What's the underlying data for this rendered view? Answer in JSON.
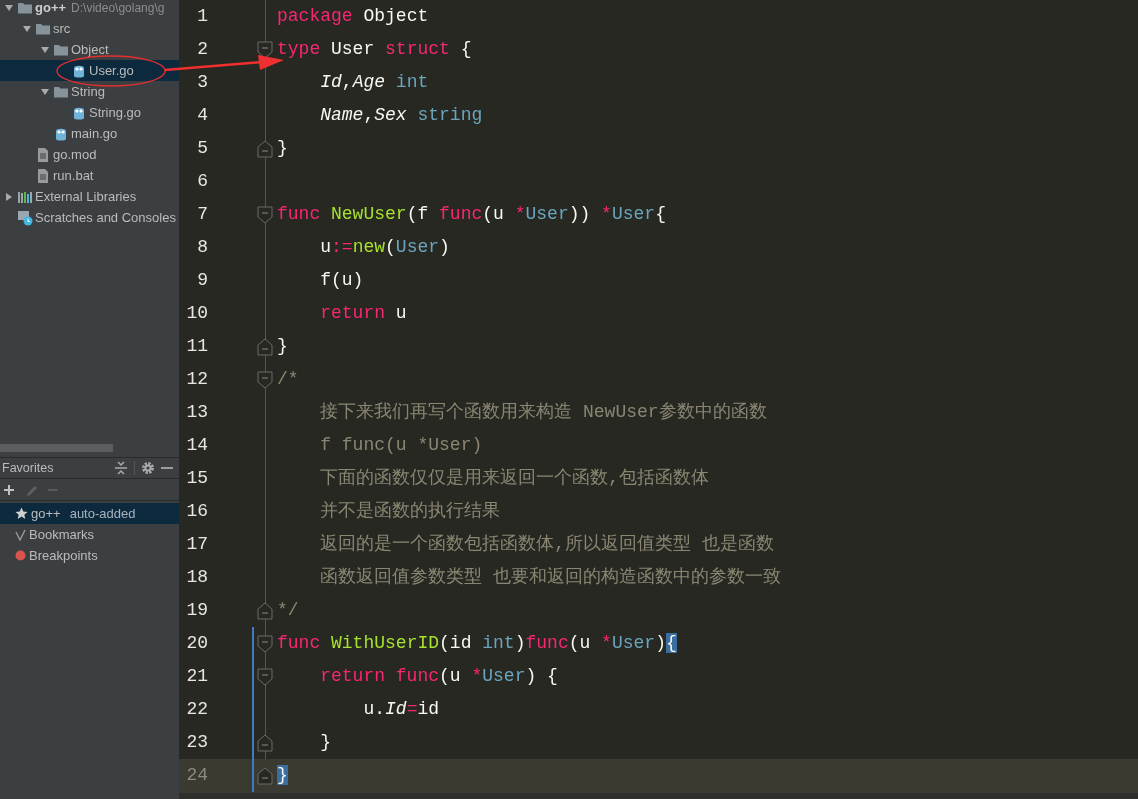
{
  "project_tree": {
    "items": [
      {
        "label": "go++",
        "path": "D:\\video\\golang\\g",
        "kind": "folder",
        "expanded": true,
        "selected": false,
        "children": [
          {
            "label": "src",
            "kind": "folder",
            "expanded": true,
            "selected": false,
            "children": [
              {
                "label": "Object",
                "kind": "folder",
                "expanded": true,
                "selected": false,
                "children": [
                  {
                    "label": "User.go",
                    "kind": "gofile",
                    "selected": true
                  }
                ]
              },
              {
                "label": "String",
                "kind": "folder",
                "expanded": true,
                "selected": false,
                "children": [
                  {
                    "label": "String.go",
                    "kind": "gofile",
                    "selected": false
                  }
                ]
              },
              {
                "label": "main.go",
                "kind": "gofile",
                "selected": false
              }
            ]
          },
          {
            "label": "go.mod",
            "kind": "file",
            "selected": false
          },
          {
            "label": "run.bat",
            "kind": "file",
            "selected": false
          }
        ]
      },
      {
        "label": "External Libraries",
        "kind": "libraries",
        "expanded": false,
        "selected": false
      },
      {
        "label": "Scratches and Consoles",
        "kind": "scratches",
        "selected": false
      }
    ]
  },
  "favorites": {
    "title": "Favorites",
    "toolbar": [
      {
        "kind": "add",
        "disabled": false
      },
      {
        "kind": "edit",
        "disabled": true
      },
      {
        "kind": "remove",
        "disabled": true
      }
    ],
    "items": [
      {
        "label": "go++",
        "note": "auto-added",
        "kind": "star",
        "selected": true
      },
      {
        "label": "Bookmarks",
        "kind": "check",
        "selected": false
      },
      {
        "label": "Breakpoints",
        "kind": "dot",
        "color": "#d9534f",
        "selected": false
      }
    ]
  },
  "editor": {
    "lines": [
      {
        "number": "1",
        "kind": "code",
        "changed": false,
        "current": false,
        "tokens": [
          {
            "kind": "kw",
            "text": "package"
          },
          {
            "kind": "plain",
            "text": " Object"
          }
        ]
      },
      {
        "number": "2",
        "kind": "fold-start",
        "changed": false,
        "current": false,
        "tokens": [
          {
            "kind": "kw",
            "text": "type"
          },
          {
            "kind": "plain",
            "text": " User "
          },
          {
            "kind": "kw",
            "text": "struct"
          },
          {
            "kind": "plain",
            "text": " {"
          }
        ]
      },
      {
        "number": "3",
        "kind": "code",
        "changed": false,
        "current": false,
        "tokens": [
          {
            "kind": "field",
            "text": "    Id"
          },
          {
            "kind": "plain",
            "text": ","
          },
          {
            "kind": "field",
            "text": "Age"
          },
          {
            "kind": "type",
            "text": " int"
          }
        ]
      },
      {
        "number": "4",
        "kind": "code",
        "changed": false,
        "current": false,
        "tokens": [
          {
            "kind": "field",
            "text": "    Name"
          },
          {
            "kind": "plain",
            "text": ","
          },
          {
            "kind": "field",
            "text": "Sex"
          },
          {
            "kind": "type",
            "text": " string"
          }
        ]
      },
      {
        "number": "5",
        "kind": "fold-end",
        "changed": false,
        "current": false,
        "tokens": [
          {
            "kind": "plain",
            "text": "}"
          }
        ]
      },
      {
        "number": "6",
        "kind": "code",
        "changed": false,
        "current": false
      },
      {
        "number": "7",
        "kind": "fold-start",
        "changed": false,
        "current": false,
        "tokens": [
          {
            "kind": "kw",
            "text": "func"
          },
          {
            "kind": "fn",
            "text": " NewUser"
          },
          {
            "kind": "plain",
            "text": "(f "
          },
          {
            "kind": "kw",
            "text": "func"
          },
          {
            "kind": "plain",
            "text": "(u "
          },
          {
            "kind": "kw",
            "text": "*"
          },
          {
            "kind": "type",
            "text": "User"
          },
          {
            "kind": "plain",
            "text": ")) "
          },
          {
            "kind": "kw",
            "text": "*"
          },
          {
            "kind": "type",
            "text": "User"
          },
          {
            "kind": "plain",
            "text": "{"
          }
        ]
      },
      {
        "number": "8",
        "kind": "code",
        "changed": false,
        "current": false,
        "tokens": [
          {
            "kind": "plain",
            "text": "    u"
          },
          {
            "kind": "kw",
            "text": ":="
          },
          {
            "kind": "fn",
            "text": "new"
          },
          {
            "kind": "plain",
            "text": "("
          },
          {
            "kind": "type",
            "text": "User"
          },
          {
            "kind": "plain",
            "text": ")"
          }
        ]
      },
      {
        "number": "9",
        "kind": "code",
        "changed": false,
        "current": false,
        "tokens": [
          {
            "kind": "plain",
            "text": "    f(u)"
          }
        ]
      },
      {
        "number": "10",
        "kind": "code",
        "changed": false,
        "current": false,
        "tokens": [
          {
            "kind": "kw",
            "text": "    return"
          },
          {
            "kind": "plain",
            "text": " u"
          }
        ]
      },
      {
        "number": "11",
        "kind": "fold-end",
        "changed": false,
        "current": false,
        "tokens": [
          {
            "kind": "plain",
            "text": "}"
          }
        ]
      },
      {
        "number": "12",
        "kind": "fold-start",
        "changed": false,
        "current": false,
        "tokens": [
          {
            "kind": "comment",
            "text": "/*"
          }
        ]
      },
      {
        "number": "13",
        "kind": "code",
        "changed": false,
        "current": false,
        "tokens": [
          {
            "kind": "comment",
            "text": "    接下来我们再写个函数用来构造 NewUser参数中的函数"
          }
        ]
      },
      {
        "number": "14",
        "kind": "code",
        "changed": false,
        "current": false,
        "tokens": [
          {
            "kind": "comment",
            "text": "    f func(u *User)"
          }
        ]
      },
      {
        "number": "15",
        "kind": "code",
        "changed": false,
        "current": false,
        "tokens": [
          {
            "kind": "comment",
            "text": "    下面的函数仅仅是用来返回一个函数,包括函数体"
          }
        ]
      },
      {
        "number": "16",
        "kind": "code",
        "changed": false,
        "current": false,
        "tokens": [
          {
            "kind": "comment",
            "text": "    并不是函数的执行结果"
          }
        ]
      },
      {
        "number": "17",
        "kind": "code",
        "changed": false,
        "current": false,
        "tokens": [
          {
            "kind": "comment",
            "text": "    返回的是一个函数包括函数体,所以返回值类型 也是函数"
          }
        ]
      },
      {
        "number": "18",
        "kind": "code",
        "changed": false,
        "current": false,
        "tokens": [
          {
            "kind": "comment",
            "text": "    函数返回值参数类型 也要和返回的构造函数中的参数一致"
          }
        ]
      },
      {
        "number": "19",
        "kind": "fold-end",
        "changed": false,
        "current": false,
        "tokens": [
          {
            "kind": "comment",
            "text": "*/"
          }
        ]
      },
      {
        "number": "20",
        "kind": "fold-start",
        "changed": true,
        "current": false,
        "tokens": [
          {
            "kind": "kw",
            "text": "func"
          },
          {
            "kind": "fn",
            "text": " WithUserID"
          },
          {
            "kind": "plain",
            "text": "(id "
          },
          {
            "kind": "type",
            "text": "int"
          },
          {
            "kind": "plain",
            "text": ")"
          },
          {
            "kind": "kw",
            "text": "func"
          },
          {
            "kind": "plain",
            "text": "(u "
          },
          {
            "kind": "kw",
            "text": "*"
          },
          {
            "kind": "type",
            "text": "User"
          },
          {
            "kind": "plain",
            "text": ")"
          },
          {
            "kind": "brace",
            "text": "{"
          }
        ]
      },
      {
        "number": "21",
        "kind": "fold-start",
        "changed": true,
        "current": false,
        "tokens": [
          {
            "kind": "kw",
            "text": "    return func"
          },
          {
            "kind": "plain",
            "text": "(u "
          },
          {
            "kind": "kw",
            "text": "*"
          },
          {
            "kind": "type",
            "text": "User"
          },
          {
            "kind": "plain",
            "text": ") {"
          }
        ]
      },
      {
        "number": "22",
        "kind": "code",
        "changed": true,
        "current": false,
        "tokens": [
          {
            "kind": "plain",
            "text": "        u."
          },
          {
            "kind": "field",
            "text": "Id"
          },
          {
            "kind": "kw",
            "text": "="
          },
          {
            "kind": "plain",
            "text": "id"
          }
        ]
      },
      {
        "number": "23",
        "kind": "fold-end",
        "changed": true,
        "current": false,
        "tokens": [
          {
            "kind": "plain",
            "text": "    }"
          }
        ]
      },
      {
        "number": "24",
        "kind": "fold-end",
        "changed": true,
        "current": true,
        "tokens": [
          {
            "kind": "brace",
            "text": "}"
          }
        ]
      }
    ]
  }
}
